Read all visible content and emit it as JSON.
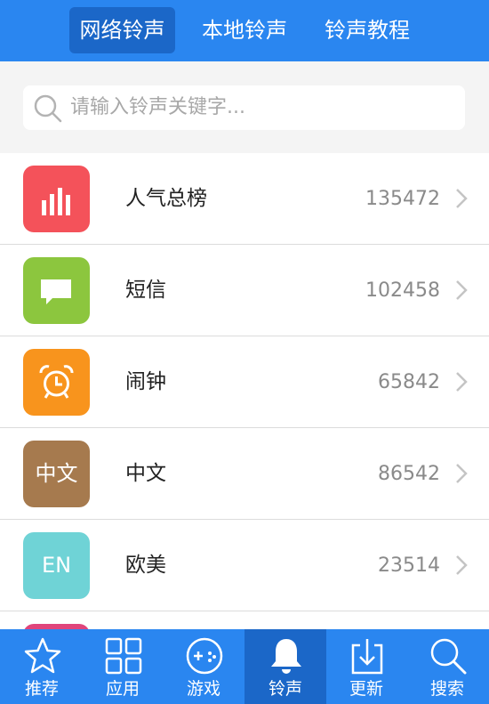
{
  "header": {
    "tabs": [
      {
        "label": "网络铃声",
        "active": true
      },
      {
        "label": "本地铃声",
        "active": false
      },
      {
        "label": "铃声教程",
        "active": false
      }
    ]
  },
  "search": {
    "placeholder": "请输入铃声关键字..."
  },
  "list": {
    "items": [
      {
        "label": "人气总榜",
        "count": "135472",
        "icon": "bar-chart-icon",
        "color": "#f4525a"
      },
      {
        "label": "短信",
        "count": "102458",
        "icon": "message-icon",
        "color": "#8cc63e"
      },
      {
        "label": "闹钟",
        "count": "65842",
        "icon": "alarm-clock-icon",
        "color": "#f8941d"
      },
      {
        "label": "中文",
        "count": "86542",
        "icon_text": "中文",
        "color": "#a67a4e"
      },
      {
        "label": "欧美",
        "count": "23514",
        "icon_text": "EN",
        "color": "#6fd3d6"
      },
      {
        "color": "#e0457b"
      }
    ]
  },
  "bottom_nav": {
    "items": [
      {
        "label": "推荐",
        "icon": "star-icon",
        "active": false
      },
      {
        "label": "应用",
        "icon": "grid-icon",
        "active": false
      },
      {
        "label": "游戏",
        "icon": "gamepad-icon",
        "active": false
      },
      {
        "label": "铃声",
        "icon": "bell-icon",
        "active": true
      },
      {
        "label": "更新",
        "icon": "download-icon",
        "active": false
      },
      {
        "label": "搜索",
        "icon": "search-icon",
        "active": false
      }
    ]
  }
}
